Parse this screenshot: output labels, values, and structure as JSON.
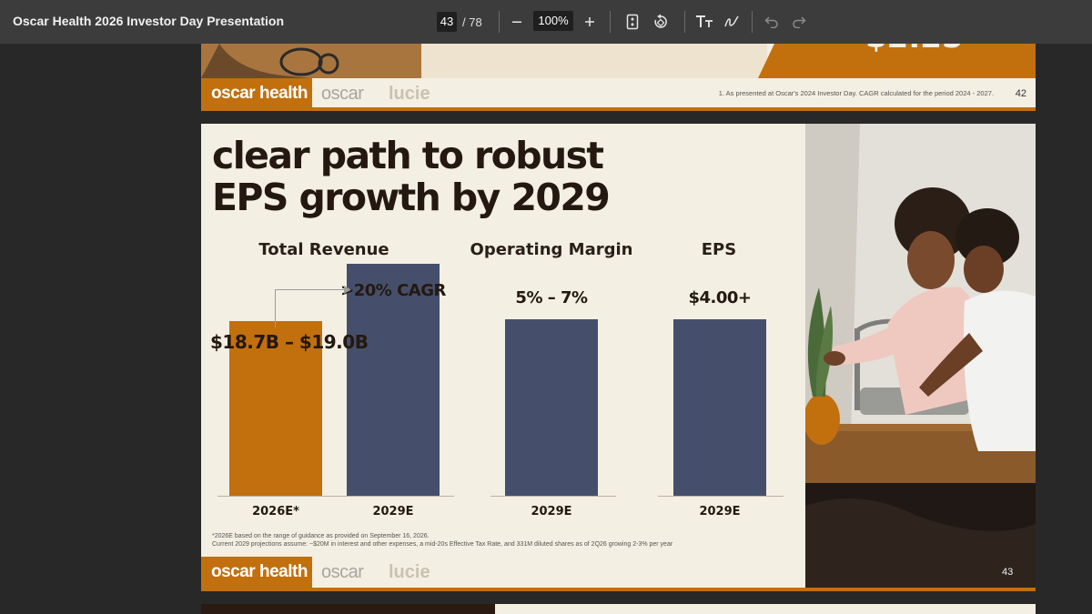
{
  "toolbar": {
    "title": "Oscar Health 2026 Investor Day Presentation",
    "page_current": "43",
    "page_total": "/ 78",
    "zoom": "100%",
    "zoom_out_icon": "minus-icon",
    "zoom_in_icon": "plus-icon"
  },
  "prev_slide": {
    "brand": "oscar health",
    "sub_brand_1": "oscar",
    "sub_brand_2": "lucie",
    "note": "1. As presented at Oscar's 2024 Investor Day. CAGR calculated for the period 2024 - 2027.",
    "page_number": "42"
  },
  "slide": {
    "headline_line1": "clear path to robust",
    "headline_line2": "EPS growth by 2029",
    "brand": "oscar health",
    "sub_brand_1": "oscar",
    "sub_brand_2": "lucie",
    "page_number": "43",
    "footnote_line1": "*2026E based on the range of guidance as provided on September 16, 2026.",
    "footnote_line2": "Current 2029 projections assume: ~$20M in interest and other expenses,  a mid-20s Effective Tax Rate, and 331M diluted shares as of 2Q26 growing 2-3% per year"
  },
  "chart_data": [
    {
      "type": "bar",
      "title": "Total Revenue",
      "categories": [
        "2026E*",
        "2029E"
      ],
      "values": [
        18.85,
        25.0
      ],
      "value_labels": [
        "$18.7B – $19.0B",
        ">20% CAGR"
      ],
      "colors": [
        "#c26f0e",
        "#454f6b"
      ]
    },
    {
      "type": "bar",
      "title": "Operating Margin",
      "categories": [
        "2029E"
      ],
      "values": [
        6.0
      ],
      "value_labels": [
        "5% – 7%"
      ],
      "colors": [
        "#454f6b"
      ]
    },
    {
      "type": "bar",
      "title": "EPS",
      "categories": [
        "2029E"
      ],
      "values": [
        4.0
      ],
      "value_labels": [
        "$4.00+"
      ],
      "colors": [
        "#454f6b"
      ]
    }
  ]
}
